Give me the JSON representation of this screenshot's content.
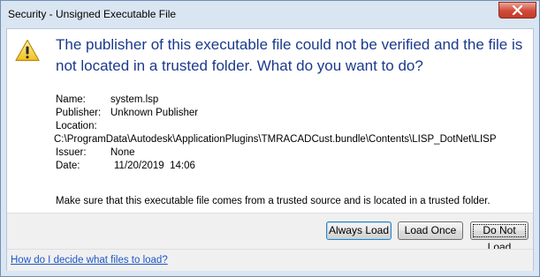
{
  "window": {
    "title": "Security - Unsigned Executable File",
    "close_icon": "close-icon"
  },
  "content": {
    "icon": "warning-icon",
    "headline": "The publisher of this executable file could not be verified and the file is not located in a trusted folder. What do you want to do?",
    "details": {
      "name_label": "Name:",
      "name_value": "system.lsp",
      "publisher_label": "Publisher:",
      "publisher_value": "Unknown Publisher",
      "location_label": "Location:",
      "location_value": "C:\\ProgramData\\Autodesk\\ApplicationPlugins\\TMRACADCust.bundle\\Contents\\LISP_DotNet\\LISP",
      "issuer_label": "Issuer:",
      "issuer_value": "None",
      "date_label": "Date:",
      "date_value": "11/20/2019  14:06"
    },
    "notice": "Make sure that this executable file comes from a trusted source and is located in a trusted folder."
  },
  "buttons": {
    "always_load": "Always Load",
    "load_once": "Load Once",
    "do_not_load": "Do Not Load"
  },
  "footer": {
    "help_link": "How do I decide what files to load?"
  }
}
